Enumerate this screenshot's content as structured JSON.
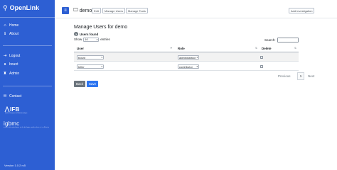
{
  "sidebar": {
    "brand": "OpenLink",
    "items": [
      {
        "label": "Home",
        "icon": "home-icon",
        "glyph": "⌂"
      },
      {
        "label": "About",
        "icon": "info-icon",
        "glyph": "ℹ"
      },
      {
        "label": "Logout",
        "icon": "logout-icon",
        "glyph": "⇥"
      },
      {
        "label": "bount",
        "icon": "user-icon",
        "glyph": "●"
      },
      {
        "label": "Admin",
        "icon": "admin-icon",
        "glyph": "♜"
      },
      {
        "label": "Contact",
        "icon": "contact-icon",
        "glyph": "✉"
      }
    ],
    "logos": {
      "ifb": "IFB",
      "ifb_sub": "Institut Français de Bioinformatique",
      "igbmc": "igbmc",
      "igbmc_sub": "institut de génétique et de biologie moléculaire et cellulaire"
    },
    "version": "Version 1.0.2 rc5"
  },
  "topbar": {
    "project": "demo",
    "buttons": {
      "edit": "Edit",
      "manage_users": "Manage Users",
      "manage_tools": "Manage Tools",
      "add_investigation": "Add investigation"
    }
  },
  "main": {
    "title": "Manage Users for demo",
    "count": "2",
    "count_label": "Users found",
    "show": "Show",
    "show_value": "10",
    "entries": "entries",
    "search_label": "Search:",
    "columns": [
      "User",
      "Role",
      "Delete"
    ],
    "rows": [
      {
        "user": "bount",
        "role": "administrator"
      },
      {
        "user": "teller",
        "role": "contributor"
      }
    ],
    "pagination": {
      "previous": "Previous",
      "page": "1",
      "next": "Next"
    },
    "back": "Back",
    "save": "Save"
  },
  "colors": {
    "sidebar": "#2d5fd3",
    "save": "#2d75f0",
    "back": "#6c757d"
  }
}
